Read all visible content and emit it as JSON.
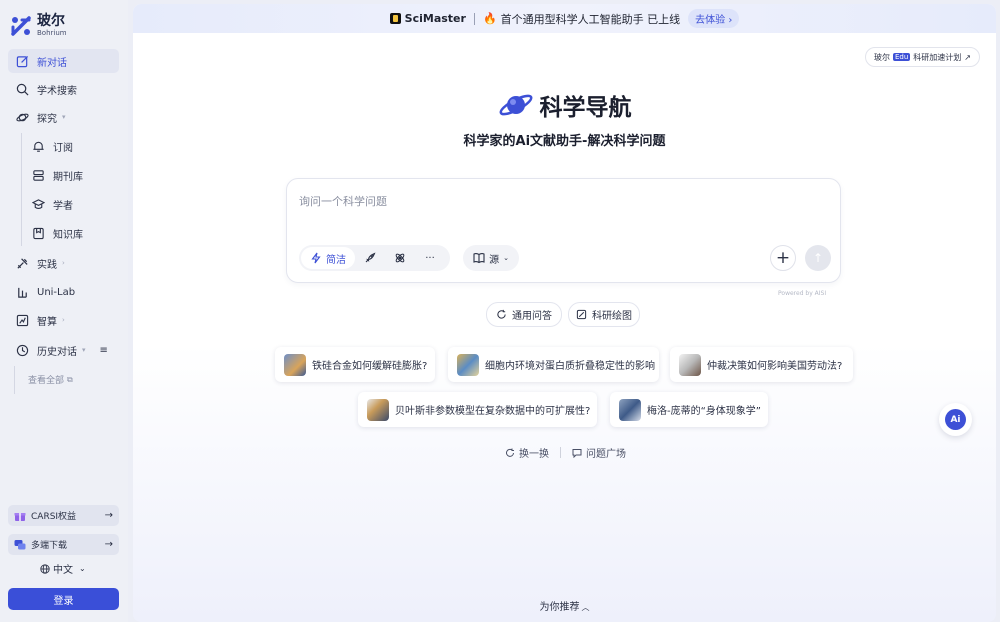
{
  "brand": {
    "name_zh": "玻尔",
    "name_en": "Bohrium"
  },
  "sidebar": {
    "items": [
      {
        "label": "新对话",
        "icon": "edit-icon"
      },
      {
        "label": "学术搜索",
        "icon": "search-icon"
      },
      {
        "label": "探究",
        "icon": "planet-icon"
      },
      {
        "label": "订阅",
        "icon": "bell-icon"
      },
      {
        "label": "期刊库",
        "icon": "database-icon"
      },
      {
        "label": "学者",
        "icon": "scholar-icon"
      },
      {
        "label": "知识库",
        "icon": "knowledge-icon"
      },
      {
        "label": "实践",
        "icon": "tools-icon"
      },
      {
        "label": "Uni-Lab",
        "icon": "lab-icon"
      },
      {
        "label": "智算",
        "icon": "compute-icon"
      },
      {
        "label": "历史对话",
        "icon": "history-icon"
      }
    ],
    "view_all": "查看全部",
    "carsi": "CARSI权益",
    "download": "多端下载",
    "language": "中文",
    "login": "登录"
  },
  "banner": {
    "product": "SciMaster",
    "text": "首个通用型科学人工智能助手 已上线",
    "cta": "去体验 ›"
  },
  "accel": {
    "prefix": "玻尔",
    "badge": "Edu",
    "label": "科研加速计划",
    "ext": "↗"
  },
  "hero": {
    "title": "科学导航",
    "subtitle": "科学家的Aⅰ文献助手-解决科学问题"
  },
  "search": {
    "placeholder": "询问一个科学问题",
    "mode_active": "简洁",
    "source": "源",
    "more": "···",
    "powered": "Powered by AISI"
  },
  "chips": [
    "通用问答",
    "科研绘图"
  ],
  "questions": [
    "铁硅合金如何缓解硅膨胀?",
    "细胞内环境对蛋白质折叠稳定性的影响",
    "仲裁决策如何影响美国劳动法?",
    "贝叶斯非参数模型在复杂数据中的可扩展性?",
    "梅洛-庞蒂的“身体现象学”"
  ],
  "footer": {
    "refresh": "换一换",
    "square": "问题广场"
  },
  "fab": "Ai",
  "recommend": "为你推荐",
  "colors": {
    "accent": "#3d50d6",
    "login": "#3a4fd8"
  }
}
